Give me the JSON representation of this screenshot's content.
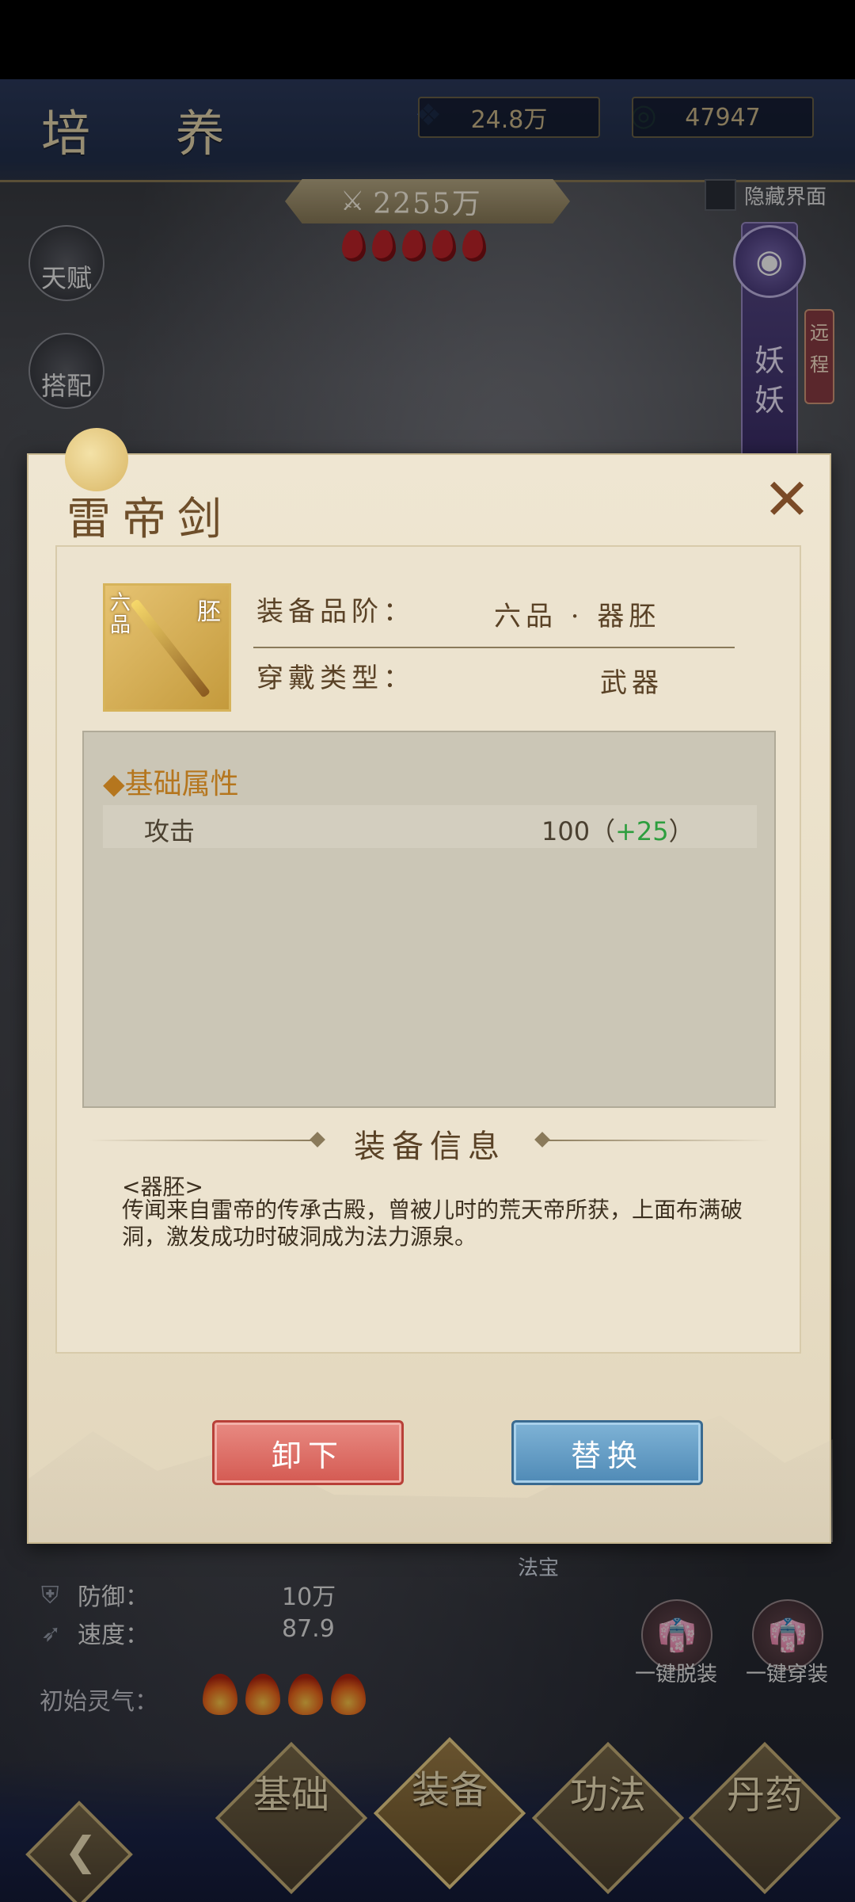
{
  "header": {
    "title": "培 养",
    "currency_jade": "24.8万",
    "currency_coin": "47947"
  },
  "power": {
    "value": "2255万"
  },
  "hide_ui": {
    "label": "隐藏界面"
  },
  "side_buttons": {
    "talent": "天赋",
    "match": "搭配"
  },
  "right_panel": {
    "pillar_text": "妖妖",
    "range_tag": "远程"
  },
  "stats": {
    "defense_label": "防御：",
    "defense_value": "10万",
    "speed_label": "速度：",
    "speed_value": "87.9",
    "aura_label": "初始灵气："
  },
  "treasure_label": "法宝",
  "quick": {
    "unequip_all": "一键脱装",
    "equip_all": "一键穿装"
  },
  "nav": [
    "基础",
    "装备",
    "功法",
    "丹药"
  ],
  "modal": {
    "title": "雷帝剑",
    "close": "✕",
    "item_grade": "六品",
    "item_tag": "胚",
    "grade_label": "装备品阶：",
    "grade_value": "六品 · 器胚",
    "type_label": "穿戴类型：",
    "type_value": "武器",
    "attr_section": "◆基础属性",
    "attributes": [
      {
        "name": "攻击",
        "value": "100",
        "bonus_prefix": "（",
        "bonus": "+25",
        "bonus_suffix": "）"
      }
    ],
    "info_section": "装备信息",
    "desc_type": "<器胚>",
    "description": "传闻来自雷帝的传承古殿，曾被儿时的荒天帝所获，上面布满破洞，激发成功时破洞成为法力源泉。",
    "unequip_button": "卸下",
    "replace_button": "替换"
  },
  "colors": {
    "header_bg": "#22304d",
    "modal_bg": "#ece3cf",
    "attr_bonus": "#2d9e3e",
    "unequip_btn": "#d45a52",
    "replace_btn": "#4f8ab6"
  }
}
